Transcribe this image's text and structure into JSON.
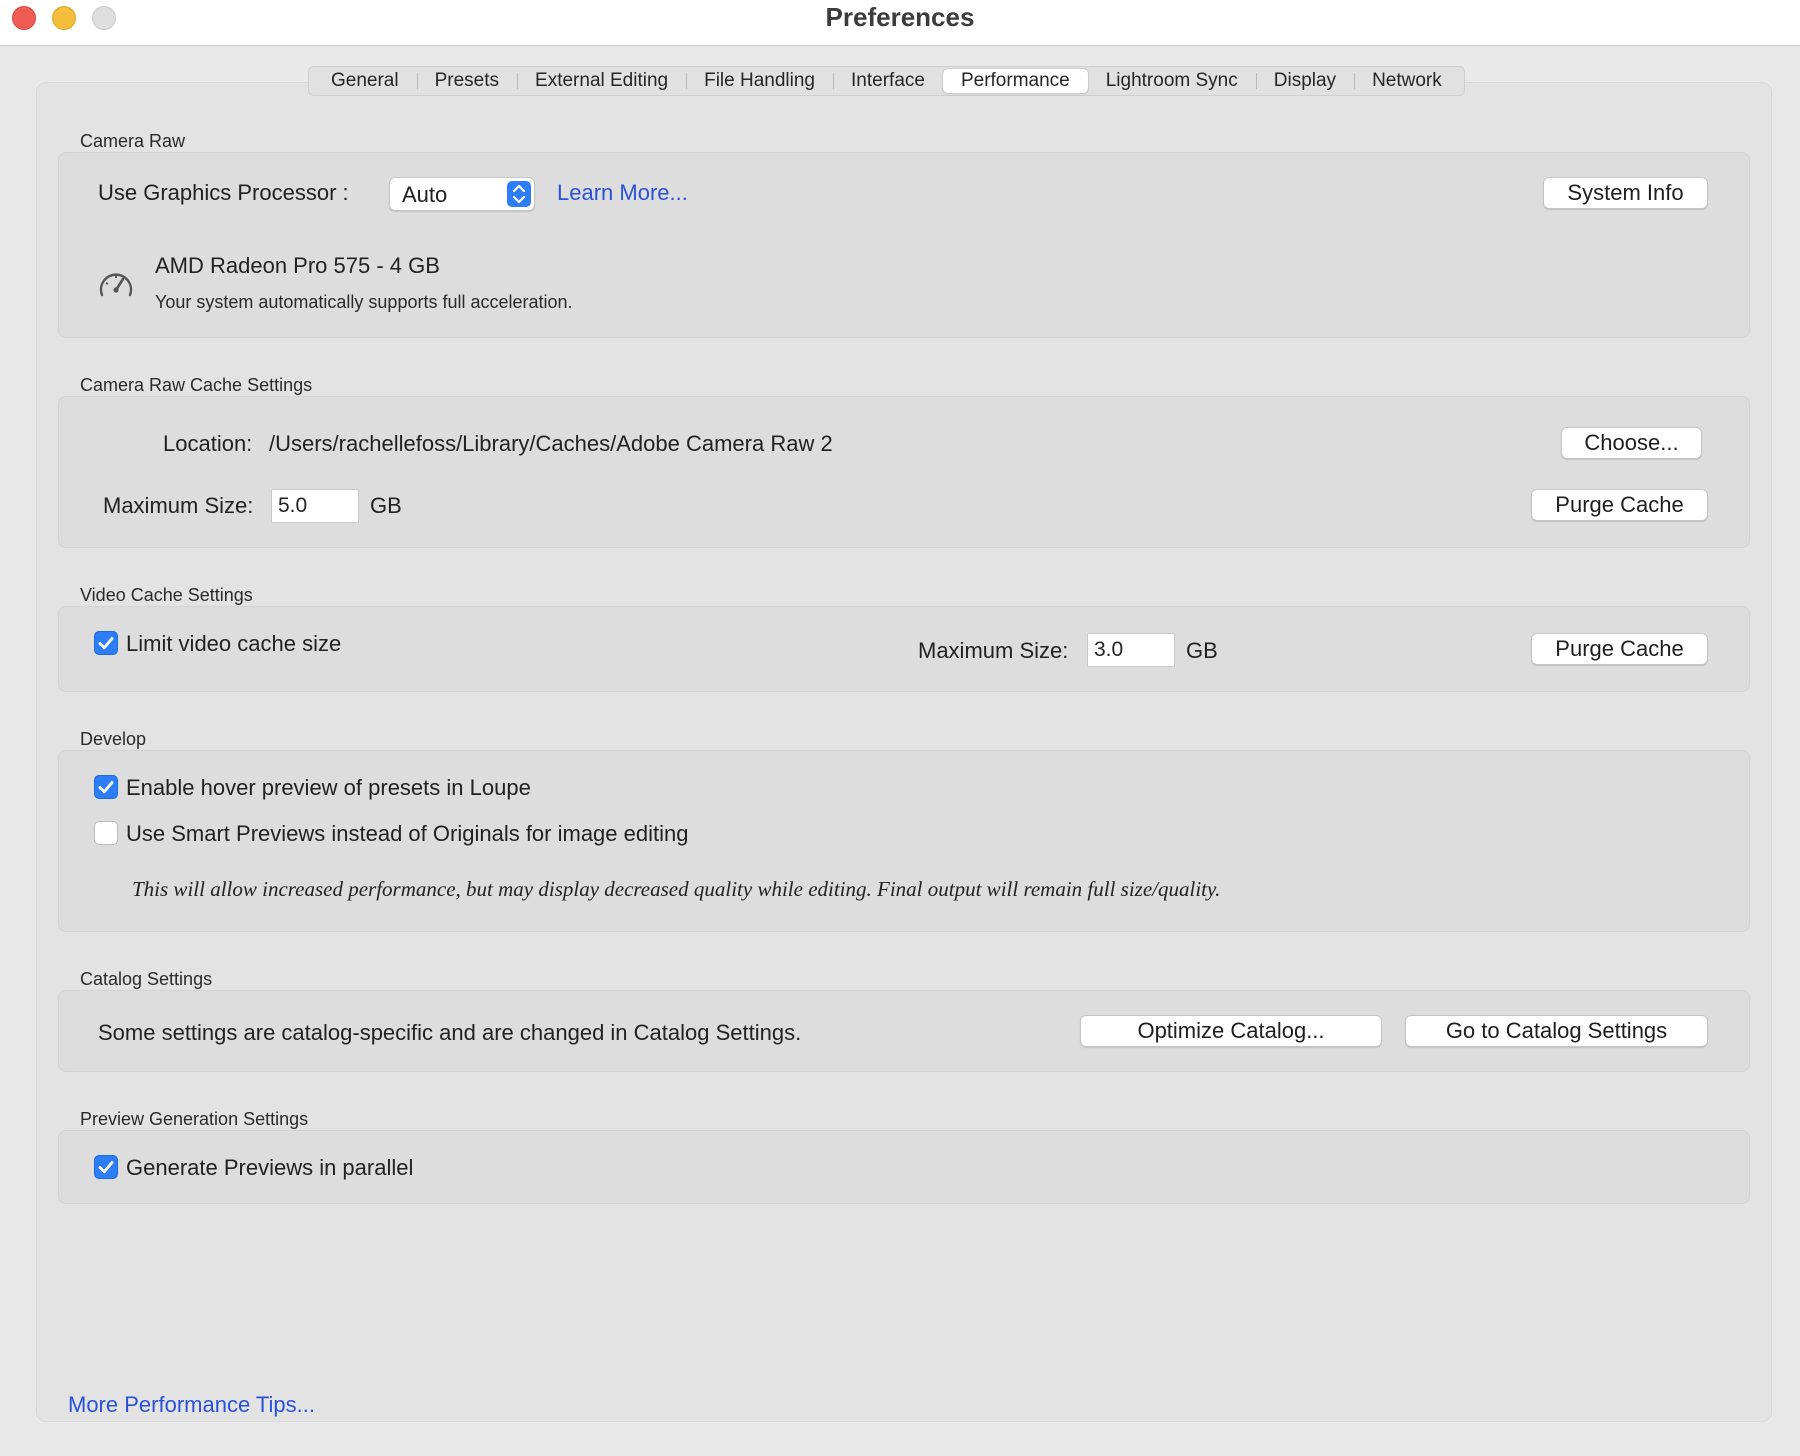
{
  "window": {
    "title": "Preferences"
  },
  "tabs": [
    {
      "label": "General"
    },
    {
      "label": "Presets"
    },
    {
      "label": "External Editing"
    },
    {
      "label": "File Handling"
    },
    {
      "label": "Interface"
    },
    {
      "label": "Performance",
      "active": true
    },
    {
      "label": "Lightroom Sync"
    },
    {
      "label": "Display"
    },
    {
      "label": "Network"
    }
  ],
  "camera_raw": {
    "section": "Camera Raw",
    "gpu_label": "Use Graphics Processor :",
    "gpu_value": "Auto",
    "learn_more": "Learn More...",
    "system_info": "System Info",
    "gpu_name": "AMD Radeon Pro 575 - 4 GB",
    "gpu_status": "Your system automatically supports full acceleration."
  },
  "cache": {
    "section": "Camera Raw Cache Settings",
    "location_label": "Location:",
    "location_value": "/Users/rachellefoss/Library/Caches/Adobe Camera Raw 2",
    "choose": "Choose...",
    "max_label": "Maximum Size:",
    "max_value": "5.0",
    "unit": "GB",
    "purge": "Purge Cache"
  },
  "video": {
    "section": "Video Cache Settings",
    "limit_label": "Limit video cache size",
    "limit_checked": true,
    "max_label": "Maximum Size:",
    "max_value": "3.0",
    "unit": "GB",
    "purge": "Purge Cache"
  },
  "develop": {
    "section": "Develop",
    "hover_label": "Enable hover preview of presets in Loupe",
    "hover_checked": true,
    "smart_label": "Use Smart Previews instead of Originals for image editing",
    "smart_checked": false,
    "note": "This will allow increased performance, but may display decreased quality while editing. Final output will remain full size/quality."
  },
  "catalog": {
    "section": "Catalog Settings",
    "text": "Some settings are catalog-specific and are changed in Catalog Settings.",
    "optimize": "Optimize Catalog...",
    "goto": "Go to Catalog Settings"
  },
  "preview": {
    "section": "Preview Generation Settings",
    "parallel_label": "Generate Previews in parallel",
    "parallel_checked": true
  },
  "footer": {
    "tips_link": "More Performance Tips..."
  },
  "colors": {
    "accent": "#2c7df6",
    "link": "#2a52d9"
  }
}
